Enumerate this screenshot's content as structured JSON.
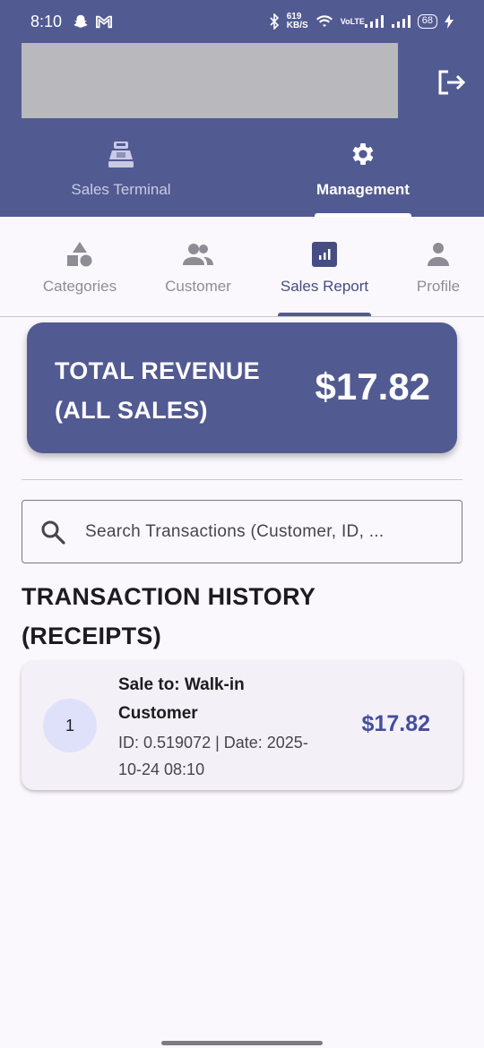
{
  "status_bar": {
    "time": "8:10",
    "net_speed": "619 KB/S",
    "carrier": "VoLTE",
    "battery": "68"
  },
  "header": {
    "top_tabs": [
      {
        "label": "Sales Terminal",
        "icon": "cash-register-icon",
        "active": false
      },
      {
        "label": "Management",
        "icon": "gear-icon",
        "active": true
      }
    ]
  },
  "sub_tabs": [
    {
      "label": "Categories",
      "icon": "categories-icon",
      "active": false
    },
    {
      "label": "Customer",
      "icon": "people-icon",
      "active": false
    },
    {
      "label": "Sales Report",
      "icon": "bar-chart-icon",
      "active": true
    },
    {
      "label": "Profile",
      "icon": "person-icon",
      "active": false
    }
  ],
  "revenue": {
    "label": "TOTAL REVENUE (ALL SALES)",
    "amount": "$17.82"
  },
  "search": {
    "placeholder": "Search Transactions (Customer, ID, ..."
  },
  "history": {
    "title": "TRANSACTION HISTORY (RECEIPTS)",
    "transactions": [
      {
        "index": "1",
        "title": "Sale to: Walk-in Customer",
        "details": "ID: 0.519072 | Date: 2025-10-24 08:10",
        "amount": "$17.82"
      }
    ]
  },
  "colors": {
    "primary": "#525a92",
    "amount": "#454d9c",
    "avatar_bg": "#dfe1fb",
    "background": "#fbf8fd"
  }
}
